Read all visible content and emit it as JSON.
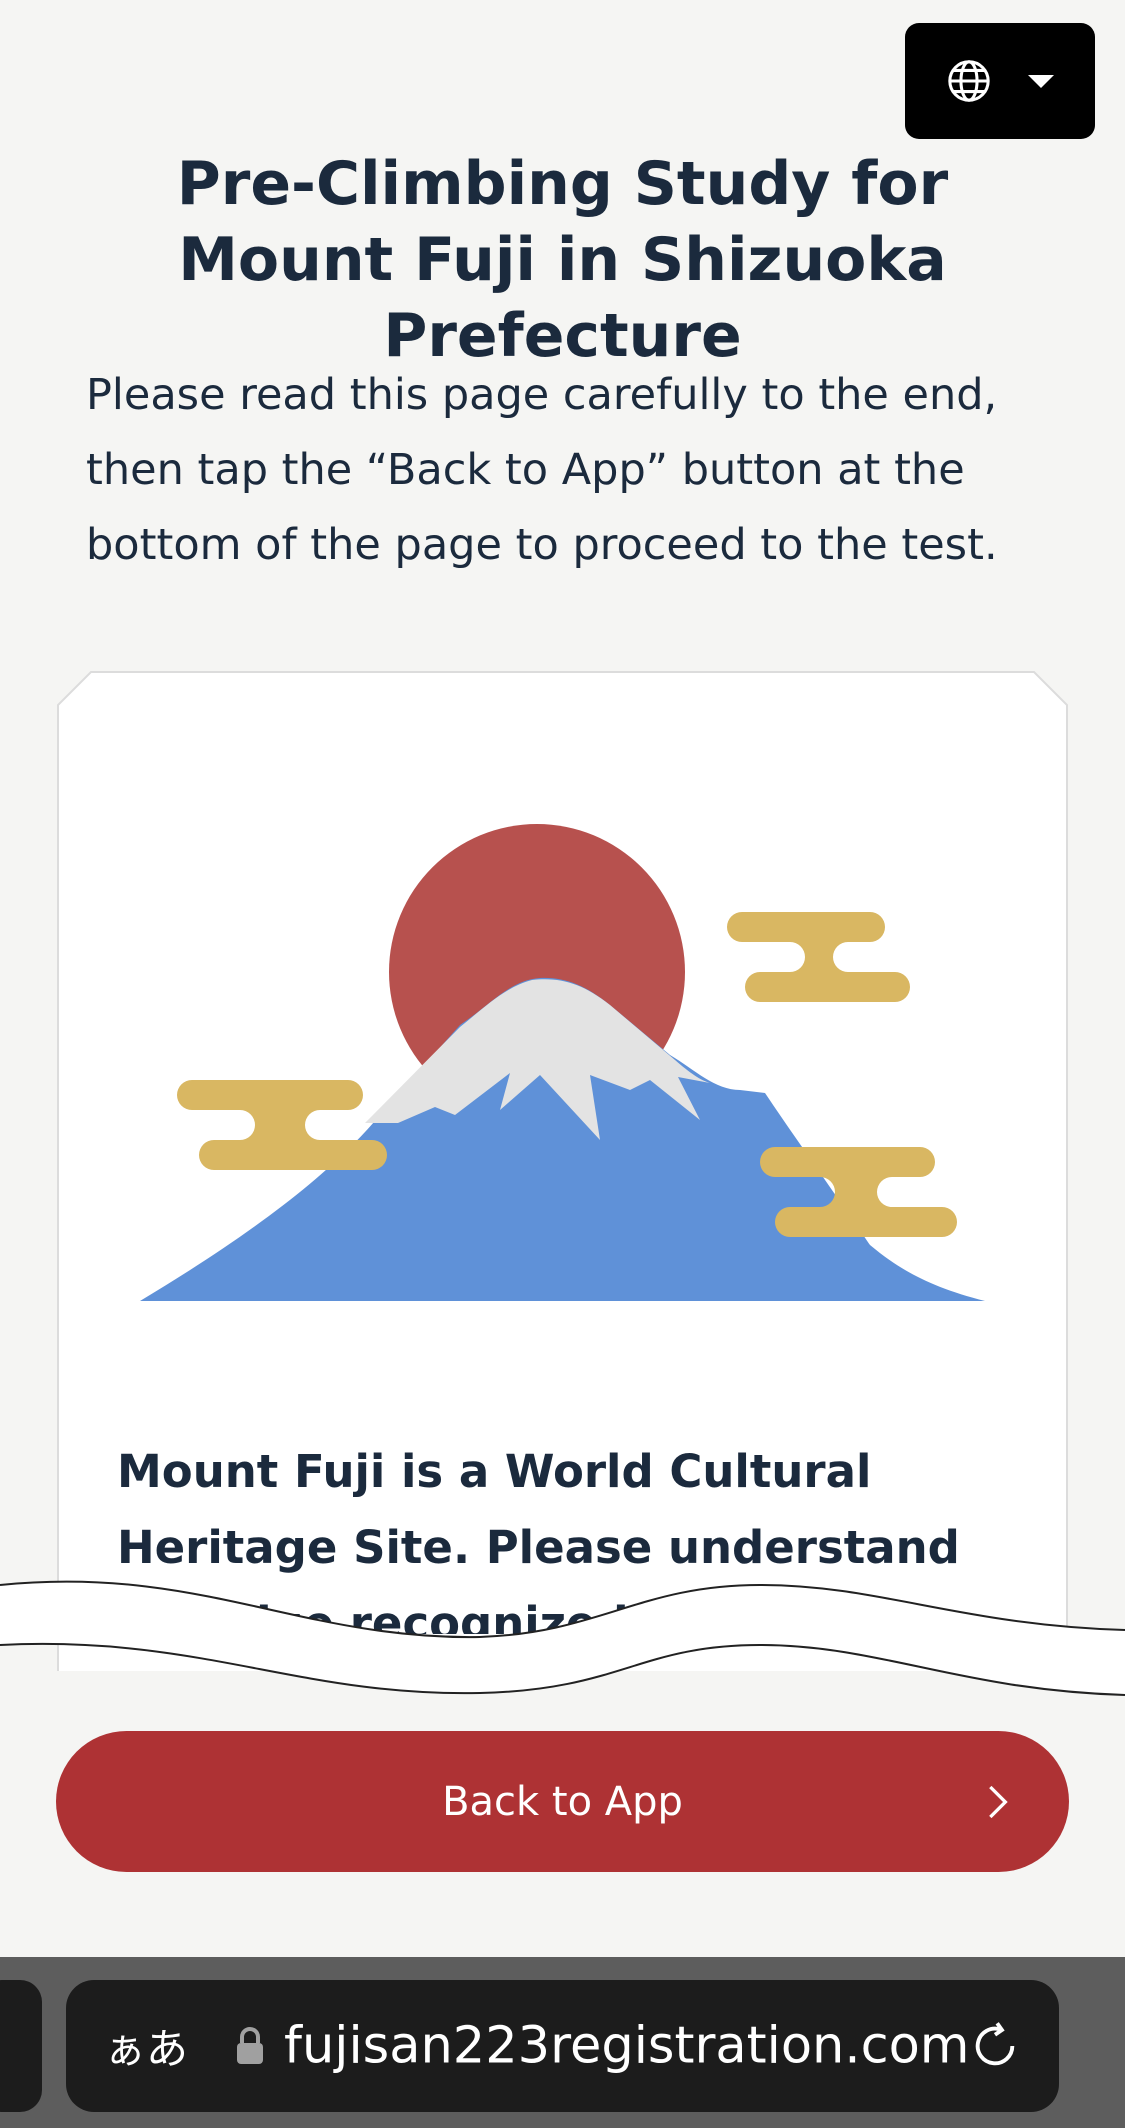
{
  "header": {
    "language_button_label": "Language"
  },
  "page": {
    "title": "Pre-Climbing Study for Mount Fuji in Shizuoka Prefecture",
    "intro": "Please read this page carefully to the end, then tap the “Back to App” button at the bottom of the page to proceed to the test."
  },
  "card": {
    "text": "Mount Fuji is a World Cultural Heritage Site. Please understand its value recognized as a World Cultural Heritage"
  },
  "footer": {
    "back_button_label": "Back to App"
  },
  "browser": {
    "text_size_label": "ぁあ",
    "url": "fujisan223registration.com"
  },
  "colors": {
    "accent": "#ae3234",
    "sun": "#b7514e",
    "mountain": "#5f91d8",
    "snow": "#e3e3e3",
    "cloud": "#d9b762",
    "text": "#1b2a3d"
  }
}
